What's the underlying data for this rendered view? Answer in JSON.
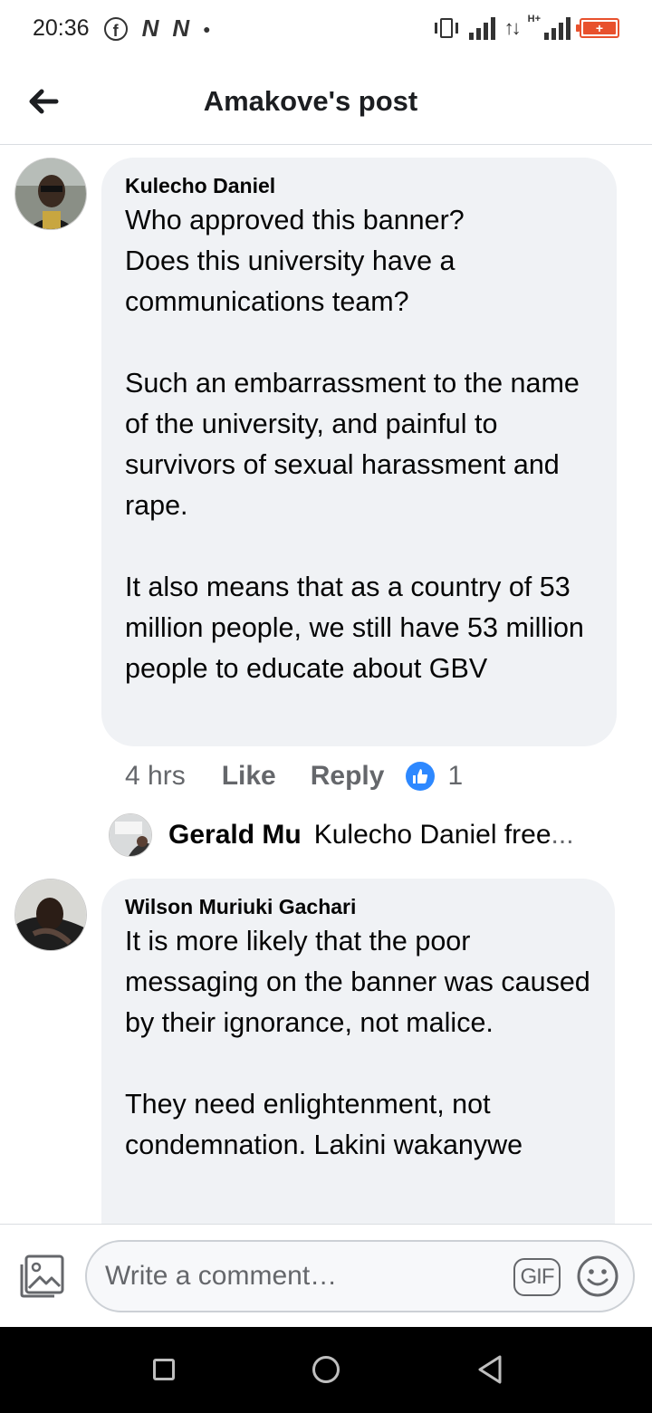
{
  "status_bar": {
    "time": "20:36",
    "network_label": "H+",
    "battery_symbol": "+",
    "icons": [
      "facebook-icon",
      "n-icon",
      "n-icon",
      "dot-icon",
      "vibrate-icon",
      "signal-icon",
      "data-arrows-icon",
      "signal-icon",
      "battery-icon"
    ]
  },
  "header": {
    "title": "Amakove's post"
  },
  "comments": [
    {
      "author": "Kulecho Daniel",
      "text": "Who approved this banner?\nDoes this university have a communications team?\n\nSuch an embarrassment to the name of the university, and painful to survivors of sexual harassment and rape.\n\nIt also means that as a country of 53 million people, we still have 53 million people to educate about GBV",
      "time": "4 hrs",
      "like_label": "Like",
      "reply_label": "Reply",
      "reaction_count": "1",
      "reply_preview": {
        "author": "Gerald Mu",
        "text": "Kulecho Daniel free",
        "ellipsis": "..."
      }
    },
    {
      "author": "Wilson Muriuki Gachari",
      "text": "It is more likely that the poor messaging on the banner was caused by their ignorance, not malice.\n\nThey need enlightenment, not condemnation. Lakini wakanywe"
    }
  ],
  "composer": {
    "placeholder": "Write a comment…",
    "gif_label": "GIF"
  },
  "colors": {
    "like_blue": "#2d88ff",
    "bubble_bg": "#f0f2f5",
    "secondary_text": "#65676b",
    "battery": "#e8512d"
  }
}
